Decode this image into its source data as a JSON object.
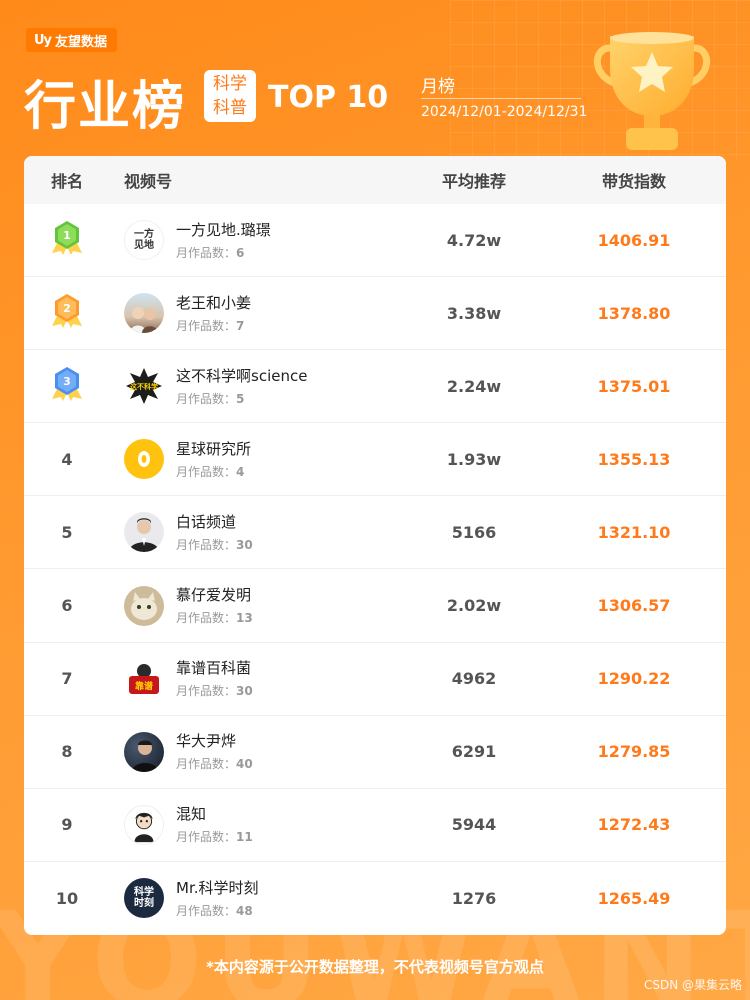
{
  "brand": {
    "name": "友望数据",
    "logo_text": "Uy"
  },
  "header": {
    "title": "行业榜",
    "category_line1": "科学",
    "category_line2": "科普",
    "top_label": "TOP 10",
    "period_type": "月榜",
    "period_range": "2024/12/01-2024/12/31"
  },
  "table": {
    "columns": {
      "rank": "排名",
      "account": "视频号",
      "avg_recommend": "平均推荐",
      "sales_index": "带货指数"
    },
    "works_label": "月作品数：",
    "rows": [
      {
        "rank": "1",
        "name": "一方见地.璐璟",
        "works": "6",
        "avg": "4.72w",
        "index": "1406.91"
      },
      {
        "rank": "2",
        "name": "老王和小姜",
        "works": "7",
        "avg": "3.38w",
        "index": "1378.80"
      },
      {
        "rank": "3",
        "name": "这不科学啊science",
        "works": "5",
        "avg": "2.24w",
        "index": "1375.01"
      },
      {
        "rank": "4",
        "name": "星球研究所",
        "works": "4",
        "avg": "1.93w",
        "index": "1355.13"
      },
      {
        "rank": "5",
        "name": "白话频道",
        "works": "30",
        "avg": "5166",
        "index": "1321.10"
      },
      {
        "rank": "6",
        "name": "慕仔爱发明",
        "works": "13",
        "avg": "2.02w",
        "index": "1306.57"
      },
      {
        "rank": "7",
        "name": "靠谱百科菌",
        "works": "30",
        "avg": "4962",
        "index": "1290.22"
      },
      {
        "rank": "8",
        "name": "华大尹烨",
        "works": "40",
        "avg": "6291",
        "index": "1279.85"
      },
      {
        "rank": "9",
        "name": "混知",
        "works": "11",
        "avg": "5944",
        "index": "1272.43"
      },
      {
        "rank": "10",
        "name": "Mr.科学时刻",
        "works": "48",
        "avg": "1276",
        "index": "1265.49"
      }
    ]
  },
  "avatar_text": {
    "a1_line1": "一方",
    "a1_line2": "见地",
    "a3": "这不科学",
    "a7": "靠谱",
    "a10_line1": "科学",
    "a10_line2": "时刻"
  },
  "footnote": "*本内容源于公开数据整理，不代表视频号官方观点",
  "credit": "CSDN @果集云略",
  "watermark": "YOUWANT",
  "colors": {
    "accent": "#ff7a1a",
    "background": "#ff8a1a",
    "gold": "#ffc24a"
  }
}
